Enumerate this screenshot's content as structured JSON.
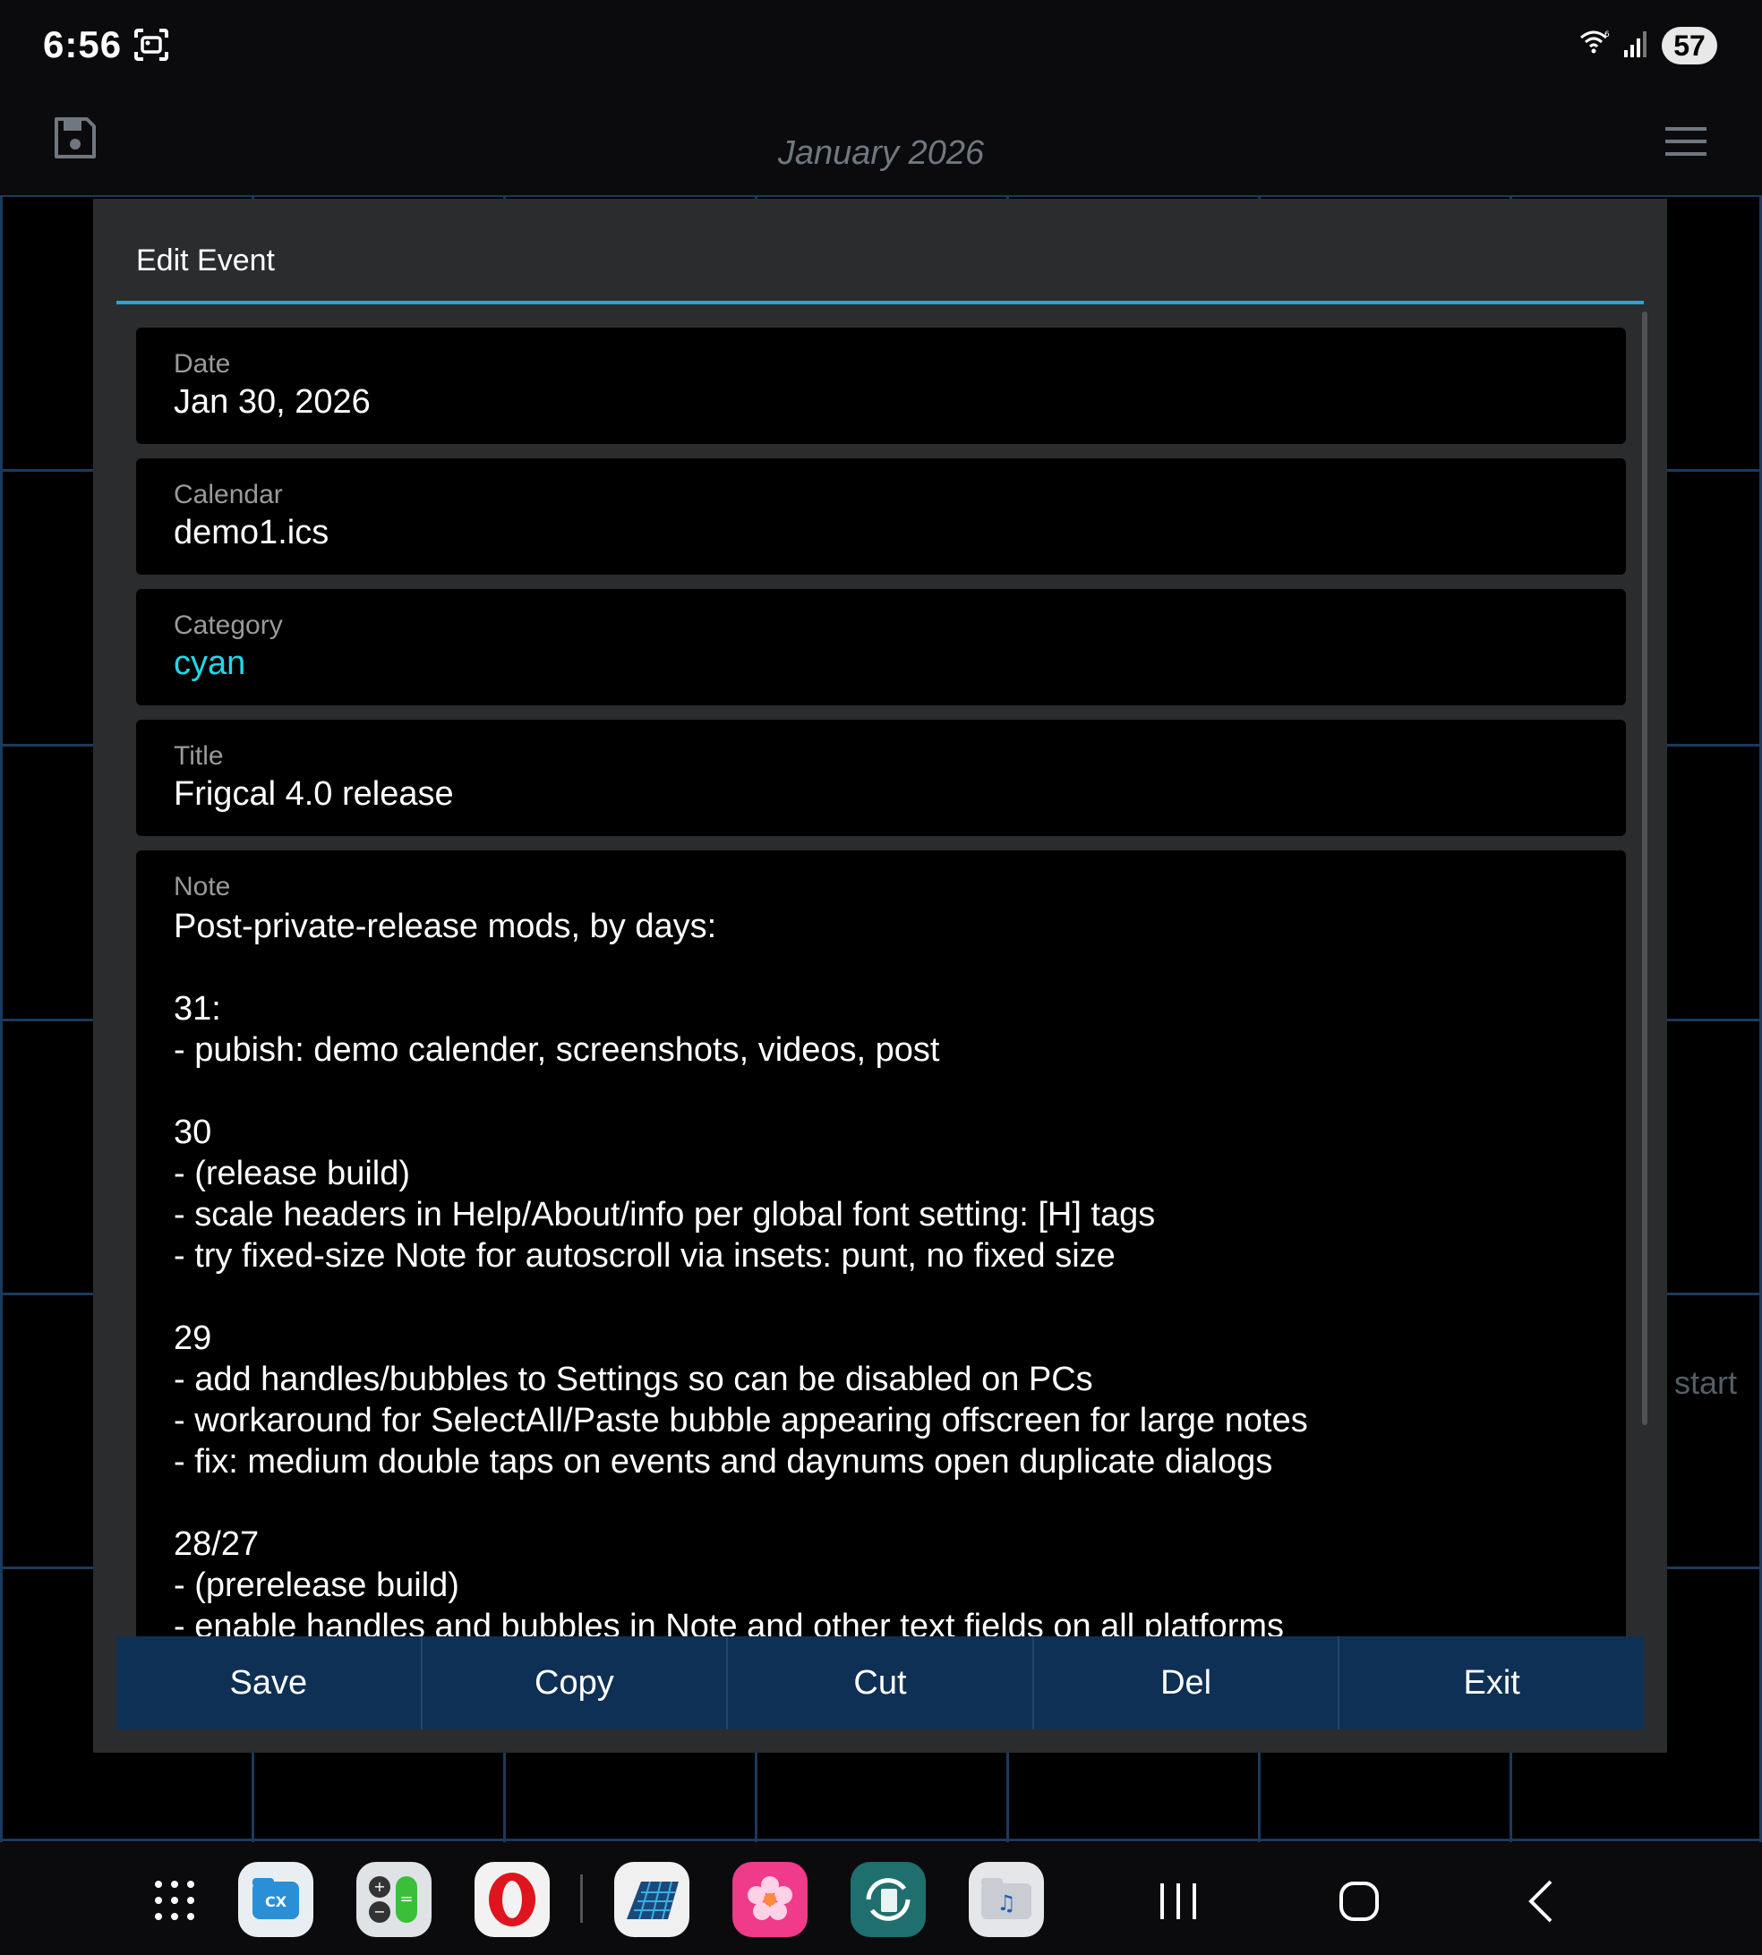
{
  "status_bar": {
    "time": "6:56",
    "battery": "57",
    "icons": [
      "screenshot-icon",
      "wifi-icon",
      "signal-icon"
    ]
  },
  "app_bar": {
    "month_title": "January 2026",
    "left_icon": "save-file-icon",
    "right_icon": "hamburger-menu-icon"
  },
  "background": {
    "visible_cell_text": "start"
  },
  "dialog": {
    "title": "Edit Event",
    "fields": {
      "date": {
        "label": "Date",
        "value": "Jan 30, 2026"
      },
      "calendar": {
        "label": "Calendar",
        "value": "demo1.ics"
      },
      "category": {
        "label": "Category",
        "value": "cyan"
      },
      "title": {
        "label": "Title",
        "value": "Frigcal 4.0 release"
      },
      "note": {
        "label": "Note",
        "value": "Post-private-release mods, by days:\n\n31:\n- pubish: demo calender, screenshots, videos, post\n\n30\n- (release build)\n- scale headers in Help/About/info per global font setting: [H] tags\n- try fixed-size Note for autoscroll via insets: punt, no fixed size\n\n29\n- add handles/bubbles to Settings so can be disabled on PCs\n- workaround for SelectAll/Paste bubble appearing offscreen for large notes\n- fix: medium double taps on events and daynums open duplicate dialogs\n\n28/27\n- (prerelease build)\n- enable handles and bubbles in Note and other text fields on all platforms"
      }
    },
    "buttons": {
      "save": "Save",
      "copy": "Copy",
      "cut": "Cut",
      "del": "Del",
      "exit": "Exit"
    }
  },
  "colors": {
    "accent_rule": "#29a3e0",
    "category_value": "#20d8e8",
    "button_bg": "#0f3055",
    "grid_line": "#1b3a5c"
  },
  "nav_bar": {
    "apps": [
      "apps-grid-icon",
      "cx-file-explorer-app-icon",
      "calculator-app-icon",
      "opera-browser-app-icon",
      "frigcal-calendar-app-icon",
      "gallery-app-icon",
      "sync-transfer-app-icon",
      "music-folder-app-icon"
    ],
    "buttons": [
      "recents-button",
      "home-button",
      "back-button"
    ]
  }
}
